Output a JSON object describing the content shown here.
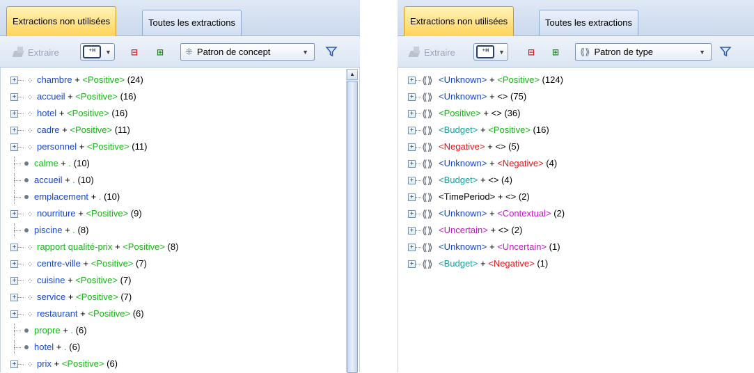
{
  "left": {
    "tabs": [
      {
        "label": "Extractions non utilisées",
        "active": true
      },
      {
        "label": "Toutes les extractions",
        "active": false
      }
    ],
    "toolbar": {
      "extract_label": "Extraire",
      "filter_icon_text": "⁺ᴴ",
      "combo_label": "Patron de concept"
    },
    "rows": [
      {
        "kind": "group",
        "term": "chambre",
        "tag": "<Positive>",
        "tag_type": "pos",
        "count": "(24)"
      },
      {
        "kind": "group",
        "term": "accueil",
        "tag": "<Positive>",
        "tag_type": "pos",
        "count": "(16)"
      },
      {
        "kind": "group",
        "term": "hotel",
        "tag": "<Positive>",
        "tag_type": "pos",
        "count": "(16)"
      },
      {
        "kind": "group",
        "term": "cadre",
        "tag": "<Positive>",
        "tag_type": "pos",
        "count": "(11)"
      },
      {
        "kind": "group",
        "term": "personnel",
        "tag": "<Positive>",
        "tag_type": "pos",
        "count": "(11)"
      },
      {
        "kind": "leaf",
        "term": "calme",
        "tag": ".",
        "tag_type": "pos",
        "count": "(10)",
        "term_color": "pos"
      },
      {
        "kind": "leaf",
        "term": "accueil",
        "tag": ".",
        "tag_type": "pos",
        "count": "(10)",
        "term_color": "term"
      },
      {
        "kind": "leaf",
        "term": "emplacement",
        "tag": ".",
        "tag_type": "pos",
        "count": "(10)",
        "term_color": "term"
      },
      {
        "kind": "group",
        "term": "nourriture",
        "tag": "<Positive>",
        "tag_type": "pos",
        "count": "(9)"
      },
      {
        "kind": "leaf",
        "term": "piscine",
        "tag": ".",
        "tag_type": "pos",
        "count": "(8)",
        "term_color": "term"
      },
      {
        "kind": "group",
        "term": "rapport qualité-prix",
        "tag": "<Positive>",
        "tag_type": "pos",
        "count": "(8)",
        "term_color": "pos"
      },
      {
        "kind": "group",
        "term": "centre-ville",
        "tag": "<Positive>",
        "tag_type": "pos",
        "count": "(7)"
      },
      {
        "kind": "group",
        "term": "cuisine",
        "tag": "<Positive>",
        "tag_type": "pos",
        "count": "(7)"
      },
      {
        "kind": "group",
        "term": "service",
        "tag": "<Positive>",
        "tag_type": "pos",
        "count": "(7)"
      },
      {
        "kind": "group",
        "term": "restaurant",
        "tag": "<Positive>",
        "tag_type": "pos",
        "count": "(6)"
      },
      {
        "kind": "leaf",
        "term": "propre",
        "tag": ".",
        "tag_type": "pos",
        "count": "(6)",
        "term_color": "pos"
      },
      {
        "kind": "leaf",
        "term": "hotel",
        "tag": ".",
        "tag_type": "pos",
        "count": "(6)",
        "term_color": "term"
      },
      {
        "kind": "group",
        "term": "prix",
        "tag": "<Positive>",
        "tag_type": "pos",
        "count": "(6)"
      }
    ]
  },
  "right": {
    "tabs": [
      {
        "label": "Extractions non utilisées",
        "active": true
      },
      {
        "label": "Toutes les extractions",
        "active": false
      }
    ],
    "toolbar": {
      "extract_label": "Extraire",
      "filter_icon_text": "⁺ᴴ",
      "combo_label": "Patron de type"
    },
    "rows": [
      {
        "a": "<Unknown>",
        "a_type": "term",
        "b": "<Positive>",
        "b_type": "pos",
        "count": "(124)"
      },
      {
        "a": "<Unknown>",
        "a_type": "term",
        "b": "<>",
        "b_type": "blk",
        "count": "(75)"
      },
      {
        "a": "<Positive>",
        "a_type": "pos",
        "b": "<>",
        "b_type": "blk",
        "count": "(36)"
      },
      {
        "a": "<Budget>",
        "a_type": "bud",
        "b": "<Positive>",
        "b_type": "pos",
        "count": "(16)"
      },
      {
        "a": "<Negative>",
        "a_type": "neg",
        "b": "<>",
        "b_type": "blk",
        "count": "(5)"
      },
      {
        "a": "<Unknown>",
        "a_type": "term",
        "b": "<Negative>",
        "b_type": "neg",
        "count": "(4)"
      },
      {
        "a": "<Budget>",
        "a_type": "bud",
        "b": "<>",
        "b_type": "blk",
        "count": "(4)"
      },
      {
        "a": "<TimePeriod>",
        "a_type": "blk",
        "b": "<>",
        "b_type": "blk",
        "count": "(2)"
      },
      {
        "a": "<Unknown>",
        "a_type": "term",
        "b": "<Contextual>",
        "b_type": "ctx",
        "count": "(2)"
      },
      {
        "a": "<Uncertain>",
        "a_type": "ctx",
        "b": "<>",
        "b_type": "blk",
        "count": "(2)"
      },
      {
        "a": "<Unknown>",
        "a_type": "term",
        "b": "<Uncertain>",
        "b_type": "ctx",
        "count": "(1)"
      },
      {
        "a": "<Budget>",
        "a_type": "bud",
        "b": "<Negative>",
        "b_type": "neg",
        "count": "(1)"
      }
    ]
  }
}
